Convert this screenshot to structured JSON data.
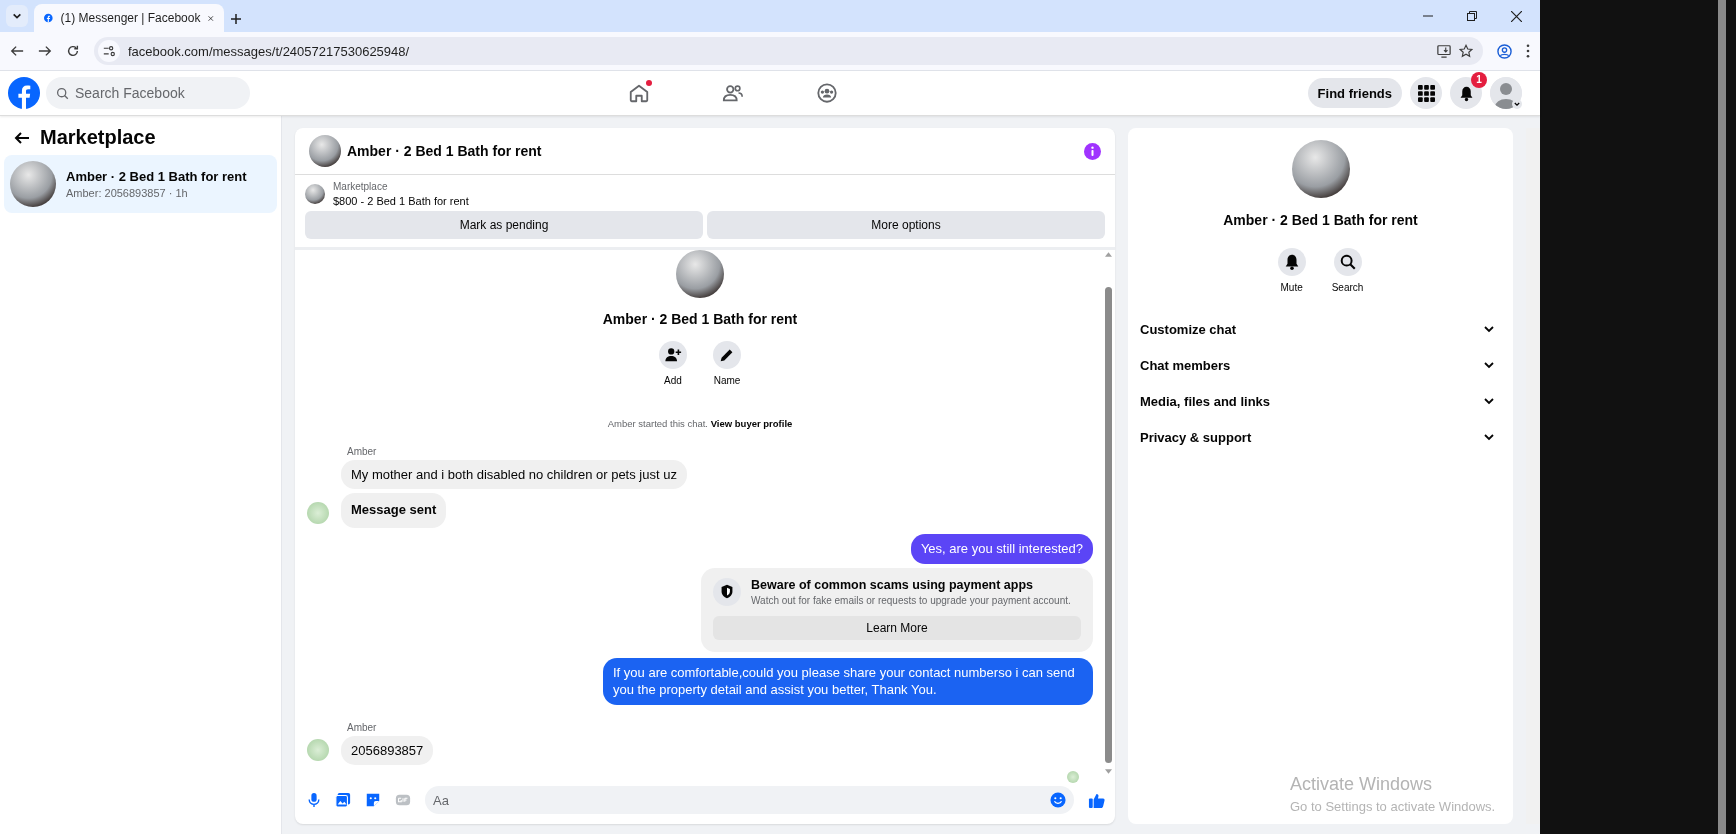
{
  "browser": {
    "tabs": [
      {
        "title": "(1) Messenger | Facebook",
        "selected": true
      }
    ],
    "url": "facebook.com/messages/t/24057217530625948/"
  },
  "header": {
    "search_placeholder": "Search Facebook",
    "nav": [
      {
        "kind": "home",
        "notification_dot": true
      },
      {
        "kind": "friends",
        "notification_dot": false
      },
      {
        "kind": "groups",
        "notification_dot": false
      }
    ],
    "find_friends": "Find friends",
    "notification_count": "1"
  },
  "sidebar": {
    "title": "Marketplace",
    "conversations": [
      {
        "title": "Amber · 2 Bed 1 Bath for rent",
        "preview": "Amber: 2056893857 · 1h",
        "selected": true
      }
    ]
  },
  "chat": {
    "title": "Amber · 2 Bed 1 Bath for rent",
    "listing": {
      "label": "Marketplace",
      "item": "$800 - 2 Bed 1 Bath for rent"
    },
    "listing_actions": [
      "Mark as pending",
      "More options"
    ],
    "profile": {
      "name": "Amber · 2 Bed 1 Bath for rent",
      "actions": [
        {
          "kind": "add",
          "label": "Add"
        },
        {
          "kind": "edit",
          "label": "Name"
        }
      ]
    },
    "notice": {
      "text": "Amber started this chat.",
      "link": "View buyer profile"
    },
    "messages": [
      {
        "kind": "incoming",
        "sender": "Amber",
        "bubbles": [
          {
            "text": "My mother and i both disabled no children or pets just uz",
            "bold": false
          },
          {
            "text": "Message sent",
            "bold": true
          }
        ]
      },
      {
        "kind": "outgoing",
        "text": "Yes, are you still interested?",
        "color": "#5b45f6"
      },
      {
        "kind": "warning",
        "title": "Beware of common scams using payment apps",
        "text": "Watch out for fake emails or requests to upgrade your payment account.",
        "button": "Learn More"
      },
      {
        "kind": "outgoing",
        "text": "If you are comfortable,could you please share your contact numberso i can send you the property detail and assist you better, Thank You.",
        "color": "#1b63f2"
      },
      {
        "kind": "incoming",
        "sender": "Amber",
        "bubbles": [
          {
            "text": "2056893857",
            "bold": false
          }
        ]
      }
    ],
    "composer_placeholder": "Aa"
  },
  "details": {
    "name": "Amber · 2 Bed 1 Bath for rent",
    "actions": [
      {
        "kind": "mute",
        "label": "Mute"
      },
      {
        "kind": "search",
        "label": "Search"
      }
    ],
    "sections": [
      {
        "label": "Customize chat",
        "expanded": false
      },
      {
        "label": "Chat members",
        "expanded": false
      },
      {
        "label": "Media, files and links",
        "expanded": false
      },
      {
        "label": "Privacy & support",
        "expanded": false
      }
    ]
  },
  "os_notice": {
    "title": "Activate Windows",
    "text": "Go to Settings to activate Windows."
  }
}
